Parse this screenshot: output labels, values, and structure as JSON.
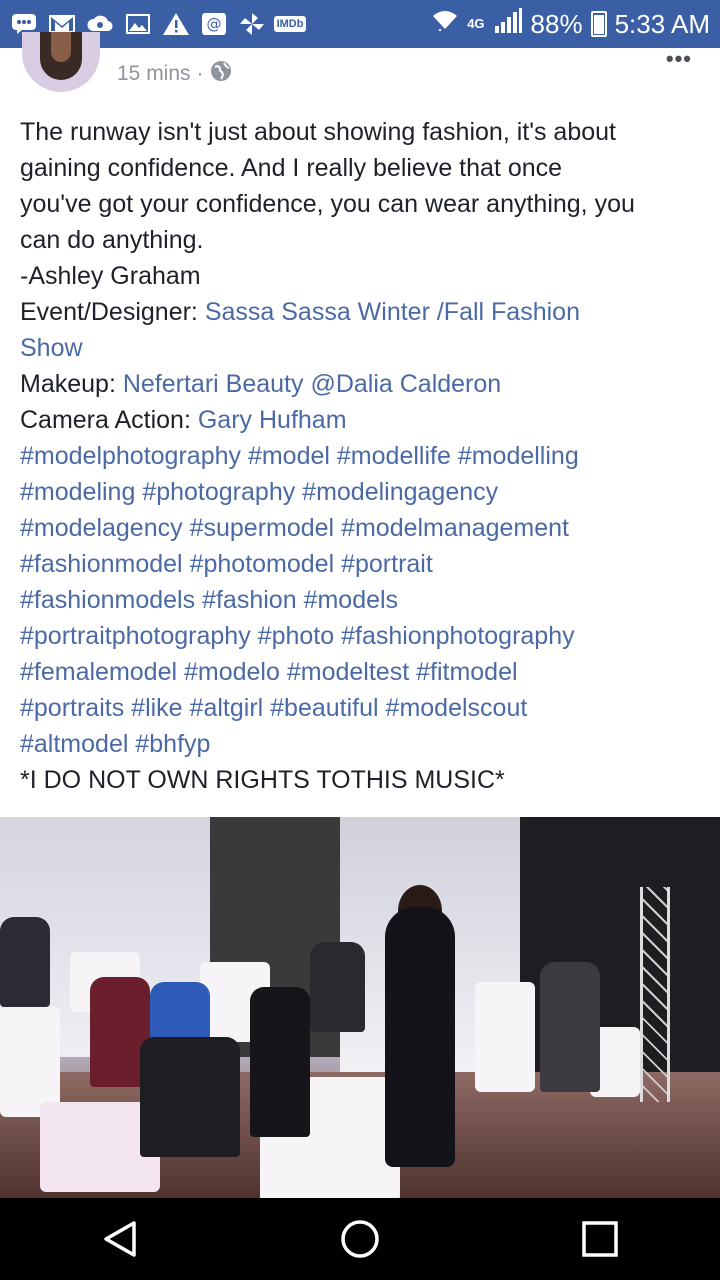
{
  "status_bar": {
    "notification_icons": [
      "chat-icon",
      "gmail-icon",
      "cloud-icon",
      "gallery-icon",
      "warning-icon",
      "at-icon",
      "pinwheel-icon",
      "imdb-icon"
    ],
    "imdb_label": "IMDb",
    "network": "4G",
    "battery": "88%",
    "battery_level": 0.88,
    "time": "5:33 AM"
  },
  "post": {
    "timestamp": "15 mins",
    "separator": "·",
    "privacy_icon": "globe-icon",
    "body": {
      "quote_l1": "The runway isn't just about showing fashion, it's about",
      "quote_l2": "gaining confidence. And I really believe that once",
      "quote_l3": "you've got your confidence, you can wear anything, you",
      "quote_l4": "can do anything.",
      "attribution": "-Ashley Graham",
      "event_label": "Event/Designer: ",
      "event_link_l1": "Sassa Sassa Winter /Fall Fashion",
      "event_link_l2": "Show",
      "makeup_label": "Makeup: ",
      "makeup_link": "Nefertari Beauty",
      "makeup_space": " ",
      "makeup_mention": "@Dalia Calderon",
      "camera_label": "Camera Action: ",
      "camera_link": "Gary Hufham",
      "hashtag_lines": [
        [
          "#modelphotography",
          "#model",
          "#modellife",
          "#modelling"
        ],
        [
          "#modeling",
          "#photography",
          "#modelingagency"
        ],
        [
          "#modelagency",
          "#supermodel",
          "#modelmanagement"
        ],
        [
          "#fashionmodel",
          "#photomodel",
          "#portrait"
        ],
        [
          "#fashionmodels",
          "#fashion",
          "#models"
        ],
        [
          "#portraitphotography",
          "#photo",
          "#fashionphotography"
        ],
        [
          "#femalemodel",
          "#modelo",
          "#modeltest",
          "#fitmodel"
        ],
        [
          "#portraits",
          "#like",
          "#altgirl",
          "#beautiful",
          "#modelscout"
        ],
        [
          "#altmodel",
          "#bhfyp"
        ]
      ],
      "disclaimer": "*I DO NOT OWN RIGHTS TOTHIS MUSIC*"
    }
  },
  "nav": {
    "back": "back-icon",
    "home": "home-icon",
    "recents": "recents-icon"
  }
}
